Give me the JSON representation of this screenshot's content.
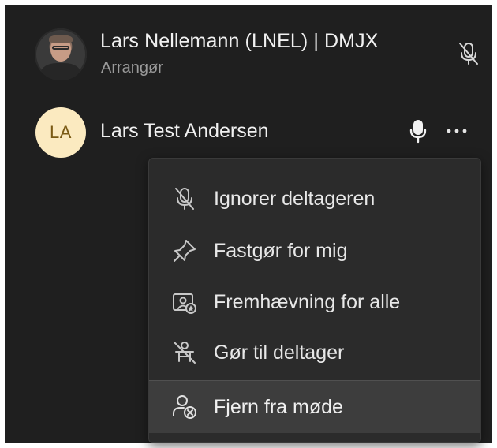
{
  "participants": [
    {
      "name": "Lars Nellemann (LNEL) | DMJX",
      "role": "Arrangør",
      "mic_icon": "mic-off-icon"
    },
    {
      "initials": "LA",
      "name": "Lars Test Andersen",
      "mic_icon": "mic-icon",
      "more_icon": "more-options-icon"
    }
  ],
  "context_menu": {
    "items": [
      {
        "label": "Ignorer deltageren",
        "icon": "mic-off-icon"
      },
      {
        "label": "Fastgør for mig",
        "icon": "pin-icon"
      },
      {
        "label": "Fremhævning for alle",
        "icon": "spotlight-icon"
      },
      {
        "label": "Gør til deltager",
        "icon": "remove-presenter-icon"
      },
      {
        "label": "Fjern fra møde",
        "icon": "remove-person-icon"
      }
    ],
    "highlighted_index": 4
  },
  "colors": {
    "background": "#1f1f1f",
    "menu": "#2b2b2b",
    "highlight": "#3d3d3d",
    "initials_bg": "#fbeac0"
  }
}
